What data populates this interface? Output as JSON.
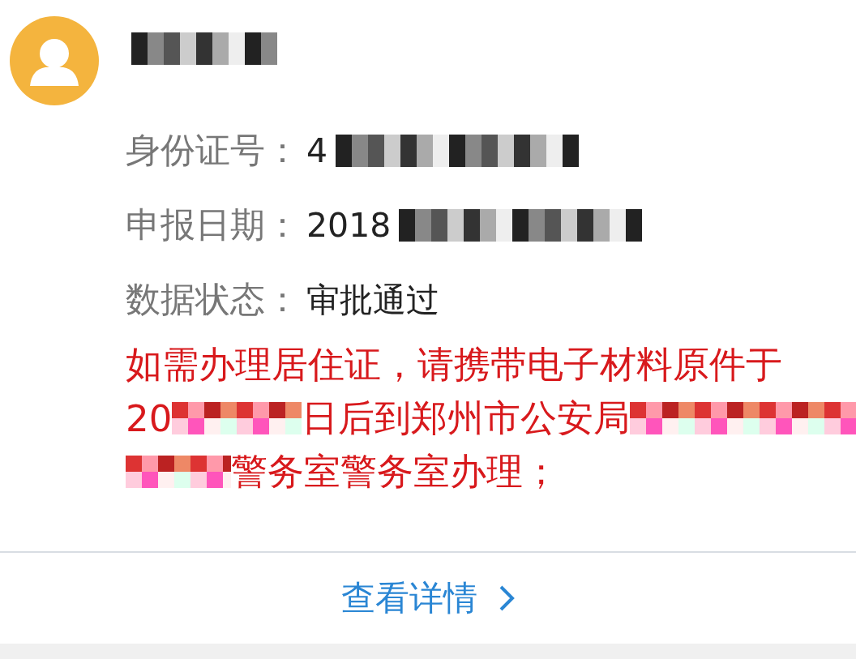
{
  "contact": {
    "avatar": {
      "kind": "person"
    },
    "name": {
      "kind": "redacted"
    }
  },
  "fields": [
    {
      "label": "身份证号：",
      "value": "4",
      "redacted": true
    },
    {
      "label": "申报日期：",
      "value": "2018",
      "redacted": true
    },
    {
      "label": "数据状态：",
      "value": "审批通过",
      "redacted": false
    }
  ],
  "notice": [
    [
      {
        "kind": "text",
        "text": "如需办理居住证，请携带电子材料原件于"
      }
    ],
    [
      {
        "kind": "text",
        "text": "20"
      },
      {
        "kind": "redacted"
      },
      {
        "kind": "text",
        "text": "日后到郑州市公安局"
      },
      {
        "kind": "redacted"
      }
    ],
    [
      {
        "kind": "redacted"
      },
      {
        "kind": "text",
        "text": "警务室警务室办理；"
      }
    ]
  ],
  "link": {
    "text": "查看详情"
  }
}
